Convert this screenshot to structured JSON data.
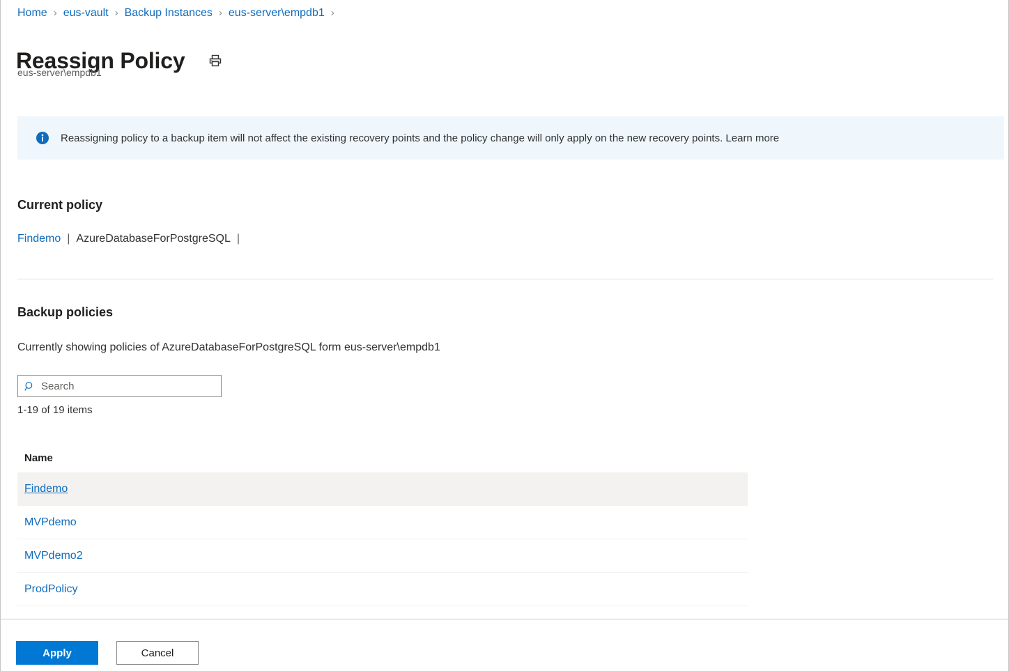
{
  "breadcrumb": {
    "items": [
      "Home",
      "eus-vault",
      "Backup Instances",
      "eus-server\\empdb1"
    ],
    "separator": "›"
  },
  "header": {
    "title": "Reassign Policy",
    "subtitle": "eus-server\\empdb1",
    "print_icon": "printer-icon"
  },
  "banner": {
    "icon": "info-icon",
    "text": "Reassigning policy to a backup item will not affect the existing recovery points and the policy change will only apply on the new recovery points. Learn more",
    "background_color": "#eff6fc",
    "icon_color": "#0f6cbd"
  },
  "current_policy": {
    "heading": "Current policy",
    "policy_name": "Findemo",
    "separator_1": "|",
    "datasource_type": "AzureDatabaseForPostgreSQL",
    "separator_2": "|"
  },
  "backup_policies": {
    "heading": "Backup policies",
    "showing_text": "Currently showing policies of AzureDatabaseForPostgreSQL form eus-server\\empdb1",
    "search": {
      "placeholder": "Search",
      "value": "",
      "icon": "search-icon"
    },
    "item_count": "1-19 of 19 items",
    "columns": [
      "Name"
    ],
    "rows": [
      {
        "name": "Findemo",
        "selected": true
      },
      {
        "name": "MVPdemo",
        "selected": false
      },
      {
        "name": "MVPdemo2",
        "selected": false
      },
      {
        "name": "ProdPolicy",
        "selected": false
      }
    ]
  },
  "footer": {
    "apply_label": "Apply",
    "cancel_label": "Cancel",
    "primary_color": "#0078d4"
  }
}
